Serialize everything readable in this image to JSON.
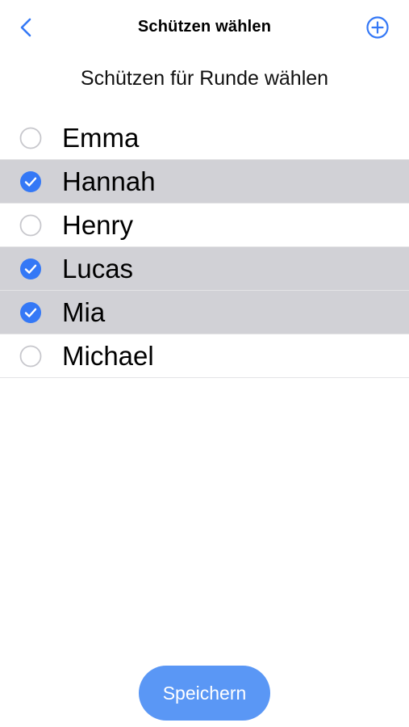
{
  "nav": {
    "title": "Schützen wählen",
    "back_icon": "chevron-left-icon",
    "add_icon": "plus-circle-icon"
  },
  "subtitle": "Schützen für Runde wählen",
  "shooters": [
    {
      "name": "Emma",
      "selected": false
    },
    {
      "name": "Hannah",
      "selected": true
    },
    {
      "name": "Henry",
      "selected": false
    },
    {
      "name": "Lucas",
      "selected": true
    },
    {
      "name": "Mia",
      "selected": true
    },
    {
      "name": "Michael",
      "selected": false
    }
  ],
  "save_label": "Speichern",
  "colors": {
    "accent": "#3478f6",
    "selected_row": "#d1d1d6",
    "save_button": "#5a97f5",
    "unchecked_border": "#c7c7cc"
  }
}
